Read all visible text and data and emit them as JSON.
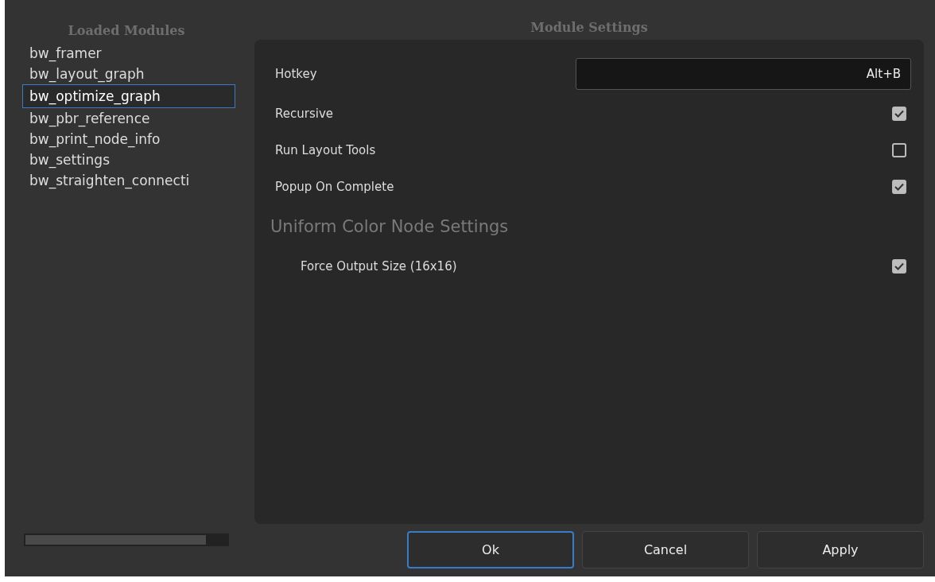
{
  "modules": {
    "title": "Loaded Modules",
    "items": [
      {
        "name": "bw_framer",
        "selected": false
      },
      {
        "name": "bw_layout_graph",
        "selected": false
      },
      {
        "name": "bw_optimize_graph",
        "selected": true
      },
      {
        "name": "bw_pbr_reference",
        "selected": false
      },
      {
        "name": "bw_print_node_info",
        "selected": false
      },
      {
        "name": "bw_settings",
        "selected": false
      },
      {
        "name": "bw_straighten_connecti",
        "selected": false
      }
    ]
  },
  "settings": {
    "title": "Module Settings",
    "rows": [
      {
        "kind": "field",
        "label": "Hotkey",
        "value": "Alt+B"
      },
      {
        "kind": "checkbox",
        "label": "Recursive",
        "checked": true
      },
      {
        "kind": "checkbox",
        "label": "Run Layout Tools",
        "checked": false
      },
      {
        "kind": "checkbox",
        "label": "Popup On Complete",
        "checked": true
      },
      {
        "kind": "section",
        "label": "Uniform Color Node Settings",
        "children": [
          {
            "kind": "checkbox",
            "label": "Force Output Size (16x16)",
            "checked": true
          }
        ]
      }
    ]
  },
  "buttons": [
    {
      "label": "Ok",
      "selected": true
    },
    {
      "label": "Cancel",
      "selected": false
    },
    {
      "label": "Apply",
      "selected": false
    }
  ]
}
